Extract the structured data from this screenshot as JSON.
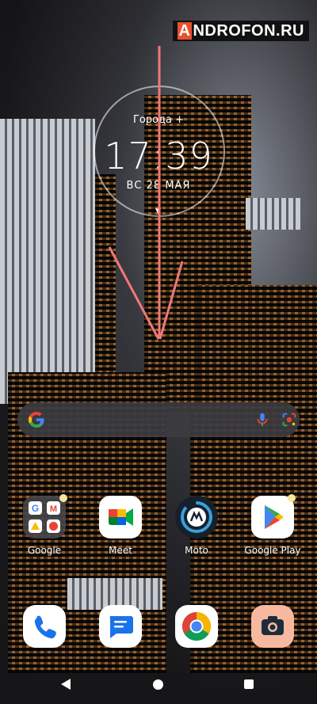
{
  "watermark": {
    "first_letter": "A",
    "rest": "NDROFON.RU"
  },
  "clock": {
    "city_label": "Города +",
    "time": "17:39",
    "date": "ВС 28 МАЯ"
  },
  "search": {
    "icons": [
      "google-g-icon",
      "microphone-icon",
      "google-lens-icon"
    ]
  },
  "apps": [
    {
      "label": "Google",
      "icon": "google-folder-icon"
    },
    {
      "label": "Meet",
      "icon": "meet-icon"
    },
    {
      "label": "Moto",
      "icon": "moto-icon"
    },
    {
      "label": "Google Play",
      "icon": "google-play-icon"
    }
  ],
  "dock": [
    {
      "icon": "phone-icon"
    },
    {
      "icon": "messages-icon"
    },
    {
      "icon": "chrome-icon"
    },
    {
      "icon": "camera-icon"
    }
  ],
  "nav": {
    "icons": [
      "back-icon",
      "home-icon",
      "recents-icon"
    ]
  },
  "colors": {
    "gesture_arrow": "#f07878",
    "watermark_accent": "#e8512a"
  }
}
